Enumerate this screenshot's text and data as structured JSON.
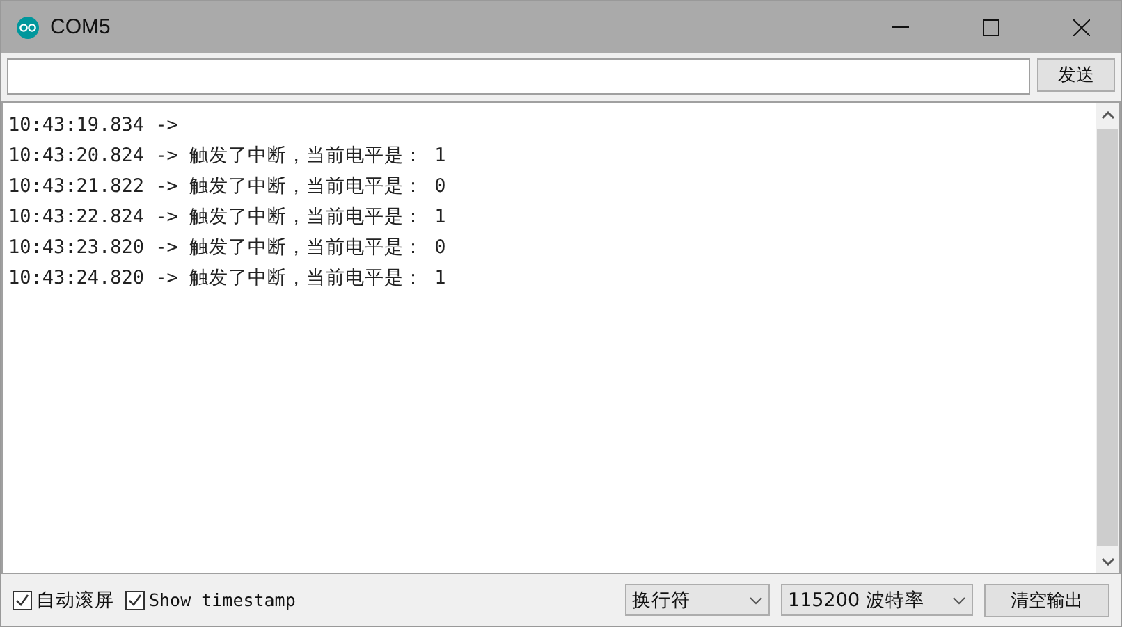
{
  "window": {
    "title": "COM5"
  },
  "send_bar": {
    "button": "发送"
  },
  "output_lines": [
    "10:43:19.834 -> ",
    "10:43:20.824 -> 触发了中断，当前电平是： 1",
    "10:43:21.822 -> 触发了中断，当前电平是： 0",
    "10:43:22.824 -> 触发了中断，当前电平是： 1",
    "10:43:23.820 -> 触发了中断，当前电平是： 0",
    "10:43:24.820 -> 触发了中断，当前电平是： 1"
  ],
  "bottom_bar": {
    "checkboxes": [
      {
        "label": "自动滚屏",
        "checked": true
      },
      {
        "label": "Show timestamp",
        "checked": true
      }
    ],
    "line_ending": "换行符",
    "baud_rate": "115200 波特率",
    "clear_button": "清空输出"
  }
}
